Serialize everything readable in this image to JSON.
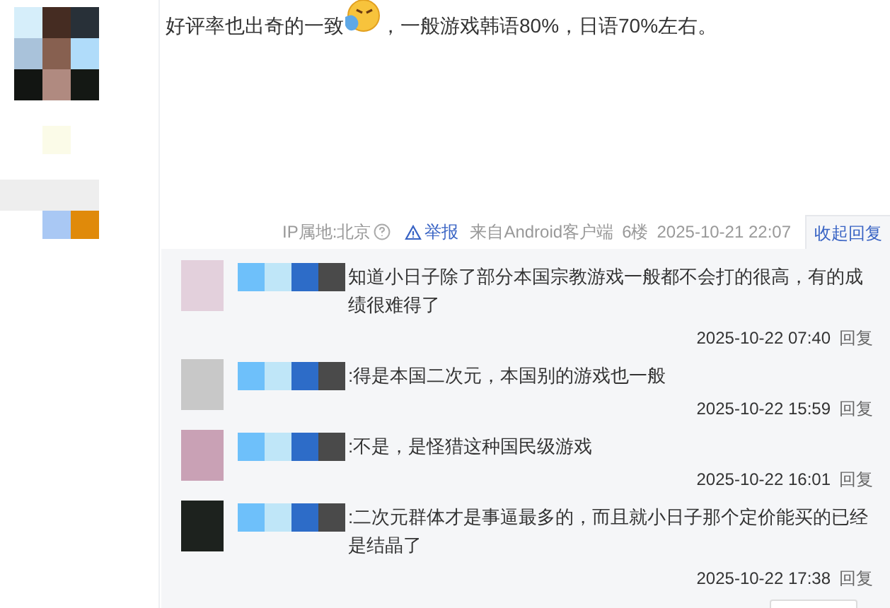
{
  "post": {
    "text_before_emoji": "好评率也出奇的一致",
    "text_after_emoji": "，一般游戏韩语80%，日语70%左右。"
  },
  "meta": {
    "ip_location": "IP属地:北京",
    "report": "举报",
    "client": "来自Android客户端",
    "floor": "6楼",
    "time": "2025-10-21 22:07",
    "collapse_replies": "收起回复"
  },
  "replies": [
    {
      "text": "知道小日子除了部分本国宗教游戏一般都不会打的很高，有的成绩很难得了",
      "time": "2025-10-22 07:40",
      "reply": "回复"
    },
    {
      "text": ":得是本国二次元，本国别的游戏也一般",
      "time": "2025-10-22 15:59",
      "reply": "回复"
    },
    {
      "text": ":不是，是怪猎这种国民级游戏",
      "time": "2025-10-22 16:01",
      "reply": "回复"
    },
    {
      "text": ":二次元群体才是事逼最多的，而且就小日子那个定价能买的已经是结晶了",
      "time": "2025-10-22 17:38",
      "reply": "回复"
    }
  ]
}
